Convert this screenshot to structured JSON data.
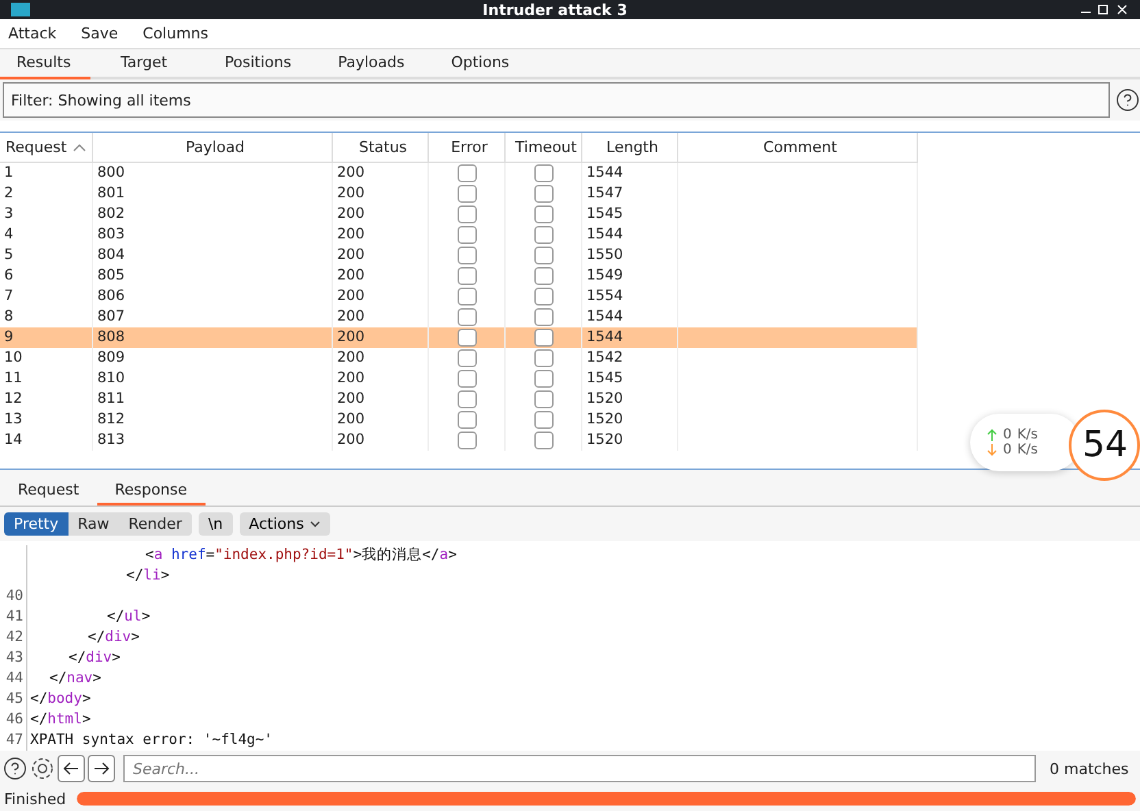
{
  "window": {
    "title": "Intruder attack 3"
  },
  "menu": [
    "Attack",
    "Save",
    "Columns"
  ],
  "tabs": [
    {
      "label": "Results",
      "selected": true
    },
    {
      "label": "Target",
      "selected": false
    },
    {
      "label": "Positions",
      "selected": false
    },
    {
      "label": "Payloads",
      "selected": false
    },
    {
      "label": "Options",
      "selected": false
    }
  ],
  "filter": {
    "value": "Filter:  Showing all items"
  },
  "table": {
    "columns": [
      {
        "label": "Request",
        "sorted": true
      },
      {
        "label": "Payload",
        "sorted": false
      },
      {
        "label": "Status",
        "sorted": false
      },
      {
        "label": "Error",
        "sorted": false
      },
      {
        "label": "Timeout",
        "sorted": false
      },
      {
        "label": "Length",
        "sorted": false
      },
      {
        "label": "Comment",
        "sorted": false
      }
    ],
    "rows": [
      {
        "request": "1",
        "payload": "800",
        "status": "200",
        "error": false,
        "timeout": false,
        "length": "1544",
        "selected": false
      },
      {
        "request": "2",
        "payload": "801",
        "status": "200",
        "error": false,
        "timeout": false,
        "length": "1547",
        "selected": false
      },
      {
        "request": "3",
        "payload": "802",
        "status": "200",
        "error": false,
        "timeout": false,
        "length": "1545",
        "selected": false
      },
      {
        "request": "4",
        "payload": "803",
        "status": "200",
        "error": false,
        "timeout": false,
        "length": "1544",
        "selected": false
      },
      {
        "request": "5",
        "payload": "804",
        "status": "200",
        "error": false,
        "timeout": false,
        "length": "1550",
        "selected": false
      },
      {
        "request": "6",
        "payload": "805",
        "status": "200",
        "error": false,
        "timeout": false,
        "length": "1549",
        "selected": false
      },
      {
        "request": "7",
        "payload": "806",
        "status": "200",
        "error": false,
        "timeout": false,
        "length": "1554",
        "selected": false
      },
      {
        "request": "8",
        "payload": "807",
        "status": "200",
        "error": false,
        "timeout": false,
        "length": "1544",
        "selected": false
      },
      {
        "request": "9",
        "payload": "808",
        "status": "200",
        "error": false,
        "timeout": false,
        "length": "1544",
        "selected": true
      },
      {
        "request": "10",
        "payload": "809",
        "status": "200",
        "error": false,
        "timeout": false,
        "length": "1542",
        "selected": false
      },
      {
        "request": "11",
        "payload": "810",
        "status": "200",
        "error": false,
        "timeout": false,
        "length": "1545",
        "selected": false
      },
      {
        "request": "12",
        "payload": "811",
        "status": "200",
        "error": false,
        "timeout": false,
        "length": "1520",
        "selected": false
      },
      {
        "request": "13",
        "payload": "812",
        "status": "200",
        "error": false,
        "timeout": false,
        "length": "1520",
        "selected": false
      },
      {
        "request": "14",
        "payload": "813",
        "status": "200",
        "error": false,
        "timeout": false,
        "length": "1520",
        "selected": false
      }
    ]
  },
  "message_tabs": [
    {
      "label": "Request",
      "selected": false
    },
    {
      "label": "Response",
      "selected": true
    }
  ],
  "view_modes": [
    {
      "label": "Pretty",
      "selected": true
    },
    {
      "label": "Raw",
      "selected": false
    },
    {
      "label": "Render",
      "selected": false
    }
  ],
  "newline_button": "\\n",
  "actions_button": "Actions",
  "code": [
    {
      "children": [
        {
          "children": [
            {
              "children": [
                {
                  "children": [
                    {
                      "children": [
                        {
                          "children": [
                            {
                              "children": [
                                {
                                  "tokens": [
                                    {
                                      "kind": "punct",
                                      "text": "<"
                                    },
                                    {
                                      "kind": "tag",
                                      "text": "a"
                                    },
                                    {
                                      "kind": "attr",
                                      "text": " href"
                                    },
                                    {
                                      "kind": "text",
                                      "text": "="
                                    },
                                    {
                                      "kind": "string",
                                      "text": "\"index.php?id=1\""
                                    },
                                    {
                                      "kind": "text",
                                      "text": ">我的消息"
                                    },
                                    {
                                      "kind": "punct",
                                      "text": "</"
                                    },
                                    {
                                      "kind": "tag",
                                      "text": "a"
                                    },
                                    {
                                      "kind": "punct",
                                      "text": ">"
                                    }
                                  ]
                                }
                              ]
                            },
                            {
                              "tokens": [
                                {
                                  "kind": "punct",
                                  "text": "</"
                                },
                                {
                                  "kind": "tag",
                                  "text": "li"
                                },
                                {
                                  "kind": "punct",
                                  "text": ">"
                                }
                              ]
                            }
                          ]
                        },
                        {
                          "number": "40"
                        },
                        {
                          "number": "41",
                          "tokens": [
                            {
                              "kind": "punct",
                              "text": "</"
                            },
                            {
                              "kind": "tag",
                              "text": "ul"
                            },
                            {
                              "kind": "punct",
                              "text": ">"
                            }
                          ]
                        }
                      ]
                    },
                    {
                      "number": "42",
                      "tokens": [
                        {
                          "kind": "punct",
                          "text": "</"
                        },
                        {
                          "kind": "tag",
                          "text": "div"
                        },
                        {
                          "kind": "punct",
                          "text": ">"
                        }
                      ]
                    }
                  ]
                },
                {
                  "number": "43",
                  "tokens": [
                    {
                      "kind": "punct",
                      "text": "</"
                    },
                    {
                      "kind": "tag",
                      "text": "div"
                    },
                    {
                      "kind": "punct",
                      "text": ">"
                    }
                  ]
                }
              ]
            },
            {
              "number": "44",
              "tokens": [
                {
                  "kind": "punct",
                  "text": "</"
                },
                {
                  "kind": "tag",
                  "text": "nav"
                },
                {
                  "kind": "punct",
                  "text": ">"
                }
              ]
            }
          ]
        },
        {
          "number": "45",
          "tokens": [
            {
              "kind": "punct",
              "text": "</"
            },
            {
              "kind": "tag",
              "text": "body"
            },
            {
              "kind": "punct",
              "text": ">"
            }
          ]
        }
      ]
    },
    {
      "number": "46",
      "tokens": [
        {
          "kind": "punct",
          "text": "</"
        },
        {
          "kind": "tag",
          "text": "html"
        },
        {
          "kind": "punct",
          "text": ">"
        }
      ]
    },
    {
      "number": "47",
      "tokens": [
        {
          "kind": "text",
          "text": "XPATH syntax error: '~fl4g~'"
        }
      ]
    }
  ],
  "search": {
    "placeholder": "Search...",
    "matches": "0 matches"
  },
  "status": {
    "label": "Finished",
    "level": 1
  },
  "speed_widget": {
    "upload": "0",
    "upload_unit": "K/s",
    "download": "0",
    "download_unit": "K/s",
    "score": "54"
  }
}
